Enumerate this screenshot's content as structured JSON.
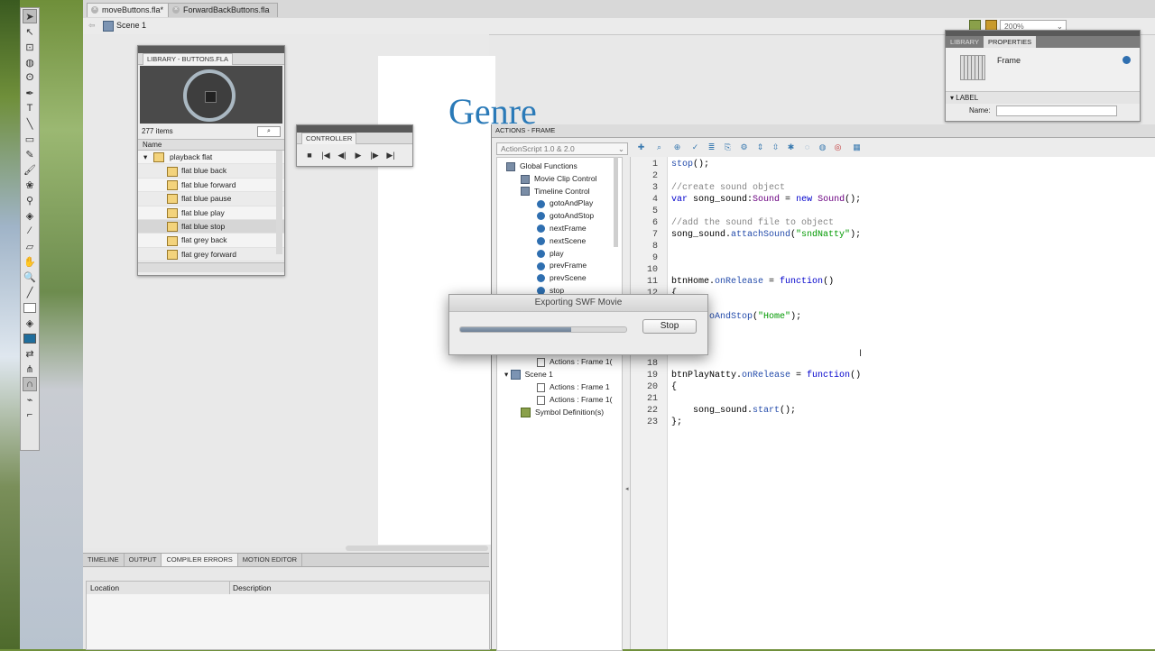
{
  "doc_tabs": [
    {
      "label": "moveButtons.fla*",
      "active": true
    },
    {
      "label": "ForwardBackButtons.fla",
      "active": false
    }
  ],
  "editbar": {
    "scene": "Scene 1",
    "zoom": "200%"
  },
  "stage": {
    "heading": "Genre"
  },
  "library": {
    "title": "LIBRARY - BUTTONS.FLA",
    "count": "277 items",
    "column_header": "Name",
    "folder": "playback flat",
    "items": [
      "flat blue back",
      "flat blue forward",
      "flat blue pause",
      "flat blue play",
      "flat blue stop",
      "flat grey back",
      "flat grey forward"
    ],
    "selected_index": 4
  },
  "controller": {
    "title": "CONTROLLER",
    "buttons": [
      "■",
      "|◀",
      "◀|",
      "▶",
      "|▶",
      "▶|"
    ]
  },
  "bottom_panel": {
    "tabs": [
      "TIMELINE",
      "OUTPUT",
      "COMPILER ERRORS",
      "MOTION EDITOR"
    ],
    "active_tab": "COMPILER ERRORS",
    "columns": [
      "Location",
      "Description"
    ]
  },
  "properties": {
    "tabs": [
      "LIBRARY",
      "PROPERTIES"
    ],
    "active_tab": "PROPERTIES",
    "type": "Frame",
    "section": "LABEL",
    "name_label": "Name:"
  },
  "actions": {
    "title": "ACTIONS - FRAME",
    "version_select": "ActionScript 1.0 & 2.0",
    "tree": [
      {
        "label": "Global Functions",
        "level": 0,
        "icon": "book"
      },
      {
        "label": "Movie Clip Control",
        "level": 1,
        "icon": "book"
      },
      {
        "label": "Timeline Control",
        "level": 1,
        "icon": "book"
      },
      {
        "label": "gotoAndPlay",
        "level": 2,
        "icon": "fn"
      },
      {
        "label": "gotoAndStop",
        "level": 2,
        "icon": "fn"
      },
      {
        "label": "nextFrame",
        "level": 2,
        "icon": "fn"
      },
      {
        "label": "nextScene",
        "level": 2,
        "icon": "fn"
      },
      {
        "label": "play",
        "level": 2,
        "icon": "fn"
      },
      {
        "label": "prevFrame",
        "level": 2,
        "icon": "fn"
      },
      {
        "label": "prevScene",
        "level": 2,
        "icon": "fn"
      },
      {
        "label": "stop",
        "level": 2,
        "icon": "fn"
      }
    ],
    "tree_lower": [
      {
        "label": "Actions : Frame 1(",
        "level": 2,
        "icon": "act"
      },
      {
        "label": "Scene 1",
        "level": 1,
        "icon": "scene"
      },
      {
        "label": "Actions : Frame 1",
        "level": 2,
        "icon": "act"
      },
      {
        "label": "Actions : Frame 1(",
        "level": 2,
        "icon": "act"
      },
      {
        "label": "Symbol Definition(s)",
        "level": 1,
        "icon": "symbol"
      }
    ],
    "line_numbers": [
      "1",
      "2",
      "3",
      "4",
      "5",
      "6",
      "7",
      "8",
      "9",
      "10",
      "11",
      "12",
      "18",
      "19",
      "20",
      "21",
      "22",
      "23"
    ],
    "code_lines": [
      "stop();",
      "",
      "//create sound object",
      "var song_sound:Sound = new Sound();",
      "",
      "//add the sound file to object",
      "song_sound.attachSound(\"sndNatty\");",
      "",
      "",
      "",
      "btnHome.onRelease = function()",
      "{",
      "    gotoAndStop(\"Home\");",
      "",
      "",
      "btnPlayNatty.onRelease = function()",
      "{",
      "",
      "    song_sound.start();",
      "};"
    ]
  },
  "export_dialog": {
    "title": "Exporting SWF Movie",
    "progress": 0.67,
    "stop_label": "Stop"
  }
}
